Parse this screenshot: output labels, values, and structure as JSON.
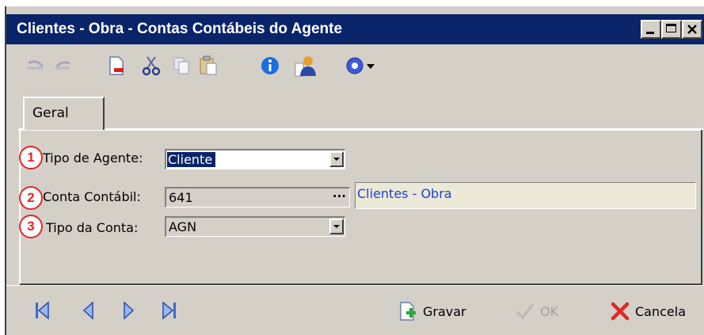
{
  "window": {
    "title": "Clientes - Obra -  Contas Contábeis do Agente"
  },
  "toolbar": {
    "items": [
      "undo-icon",
      "redo-icon",
      "new-document-icon",
      "cut-icon",
      "copy-icon",
      "paste-icon",
      "info-icon",
      "user-icon",
      "help-icon",
      "chevron-down-icon"
    ]
  },
  "tabs": [
    {
      "label": "Geral"
    }
  ],
  "form": {
    "rows": [
      {
        "marker": "1",
        "label": "Tipo de Agente:",
        "value": "Cliente"
      },
      {
        "marker": "2",
        "label": "Conta Contábil:",
        "value": "641",
        "description": "Clientes - Obra"
      },
      {
        "marker": "3",
        "label": "Tipo da Conta:",
        "value": "AGN"
      }
    ]
  },
  "footer": {
    "nav": [
      "first-record-icon",
      "previous-record-icon",
      "next-record-icon",
      "last-record-icon"
    ],
    "save_label": "Gravar",
    "ok_label": "OK",
    "cancel_label": "Cancela"
  },
  "colors": {
    "titlebar": "#0a246a",
    "window_bg": "#d4d0c8",
    "marker_red": "#e3262b",
    "description_text": "#1f3fd4"
  }
}
